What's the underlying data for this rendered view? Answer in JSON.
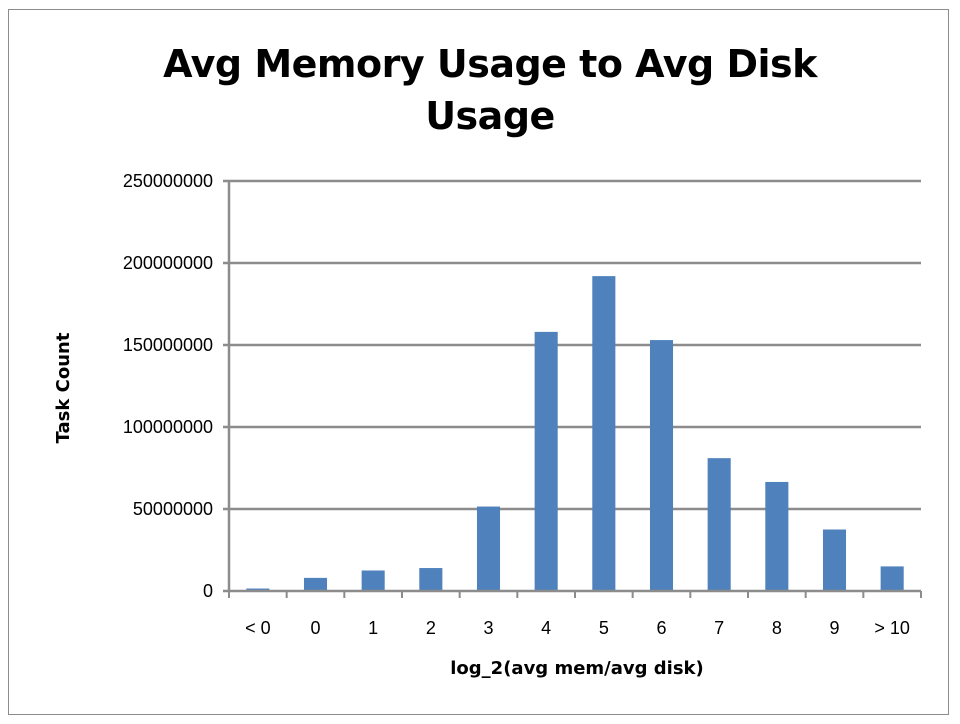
{
  "chart_data": {
    "type": "bar",
    "title_line1": "Avg Memory Usage to Avg Disk",
    "title_line2": "Usage",
    "xlabel": "log_2(avg  mem/avg disk)",
    "ylabel": "Task Count",
    "categories": [
      "< 0",
      "0",
      "1",
      "2",
      "3",
      "4",
      "5",
      "6",
      "7",
      "8",
      "9",
      "> 10"
    ],
    "values": [
      1500000,
      8000000,
      12500000,
      14000000,
      51500000,
      158000000,
      192000000,
      153000000,
      81000000,
      66500000,
      37500000,
      15000000
    ],
    "ylim": [
      0,
      250000000
    ],
    "yticks": [
      "0",
      "50000000",
      "100000000",
      "150000000",
      "200000000",
      "250000000"
    ],
    "bar_color": "#4F81BD",
    "grid": true,
    "legend": "none"
  }
}
